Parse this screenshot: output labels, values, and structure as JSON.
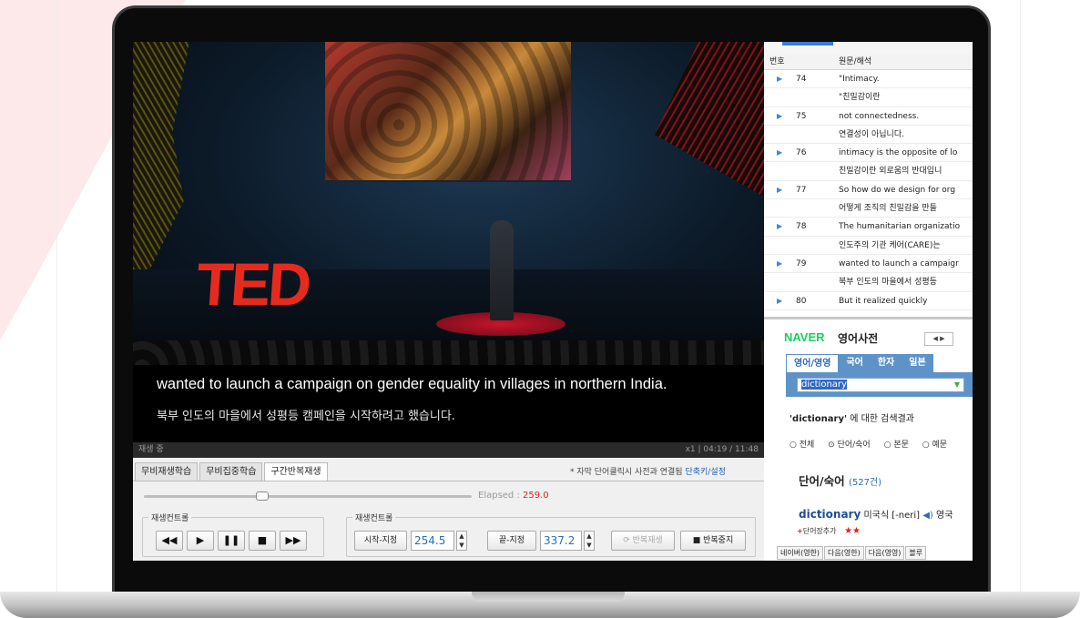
{
  "video": {
    "brand_text": "TED",
    "subtitle_en": "wanted to launch a campaign on gender equality in villages in northern India.",
    "subtitle_ko": "북부 인도의 마을에서 성평등  캠페인을 시작하려고 했습니다."
  },
  "status": {
    "state": "재생 중",
    "info": "x1  |  04:19 / 11:48"
  },
  "panel": {
    "tabs": [
      "무비재생학습",
      "무비집중학습",
      "구간반복재생"
    ],
    "active_tab": "구간반복재생",
    "hint": "* 자막 단어클릭시 사전과 연결됨",
    "hint_link": "단축키/설정",
    "elapsed_label": "Elapsed :",
    "elapsed_value": "259.0",
    "progress_fraction": 0.36,
    "group1_label": "재생컨트롤",
    "group2_label": "재생컨트롤",
    "controls": {
      "rewind": "◀◀",
      "play": "▶",
      "pause": "❚❚",
      "stop": "■",
      "forward": "▶▶"
    },
    "start_button": "시작-지정",
    "start_value": "254.5",
    "end_button": "끝-지정",
    "end_value": "337.2",
    "repeat_button": "반복재생",
    "stop_repeat_button": "반복중지"
  },
  "script_grid": {
    "col_num": "번호",
    "col_text": "원문/해석",
    "rows": [
      {
        "num": "74",
        "text": "\"Intimacy."
      },
      {
        "num": "",
        "text": "\"친밀감이란"
      },
      {
        "num": "75",
        "text": "not connectedness."
      },
      {
        "num": "",
        "text": "연결성이 아닙니다."
      },
      {
        "num": "76",
        "text": "intimacy is the opposite of lo"
      },
      {
        "num": "",
        "text": "친밀감이란 외로움의 반대입니"
      },
      {
        "num": "77",
        "text": "So how do we design for org"
      },
      {
        "num": "",
        "text": "어떻게 조직의 친밀감을 만들"
      },
      {
        "num": "78",
        "text": "The humanitarian organizatio"
      },
      {
        "num": "",
        "text": "인도주의 기관 케어(CARE)는"
      },
      {
        "num": "79",
        "text": "wanted to launch a campaigr"
      },
      {
        "num": "",
        "text": "북부 인도의 마을에서 성평등"
      },
      {
        "num": "80",
        "text": "But it realized quickly"
      }
    ]
  },
  "dictionary": {
    "brand": "NAVER",
    "title": "영어사전",
    "nav": "◀ ▶",
    "tabs": [
      "영어/영영",
      "국어",
      "한자",
      "일본"
    ],
    "query": "dictionary",
    "result_word": "'dictionary'",
    "result_suffix": " 에 대한 검색결과",
    "filters": [
      "전체",
      "단어/숙어",
      "본문",
      "예문"
    ],
    "selected_filter": "단어/숙어",
    "section_title": "단어/숙어",
    "section_count": "(527건)",
    "entry_word": "dictionary",
    "entry_pron": " 미국식 [-neri] ",
    "entry_tail": " 영국",
    "add_word": "단어장추가",
    "stars": "★★",
    "bottom_tabs": [
      "네이버(영한)",
      "다음(영한)",
      "다음(영영)",
      "블루"
    ]
  }
}
